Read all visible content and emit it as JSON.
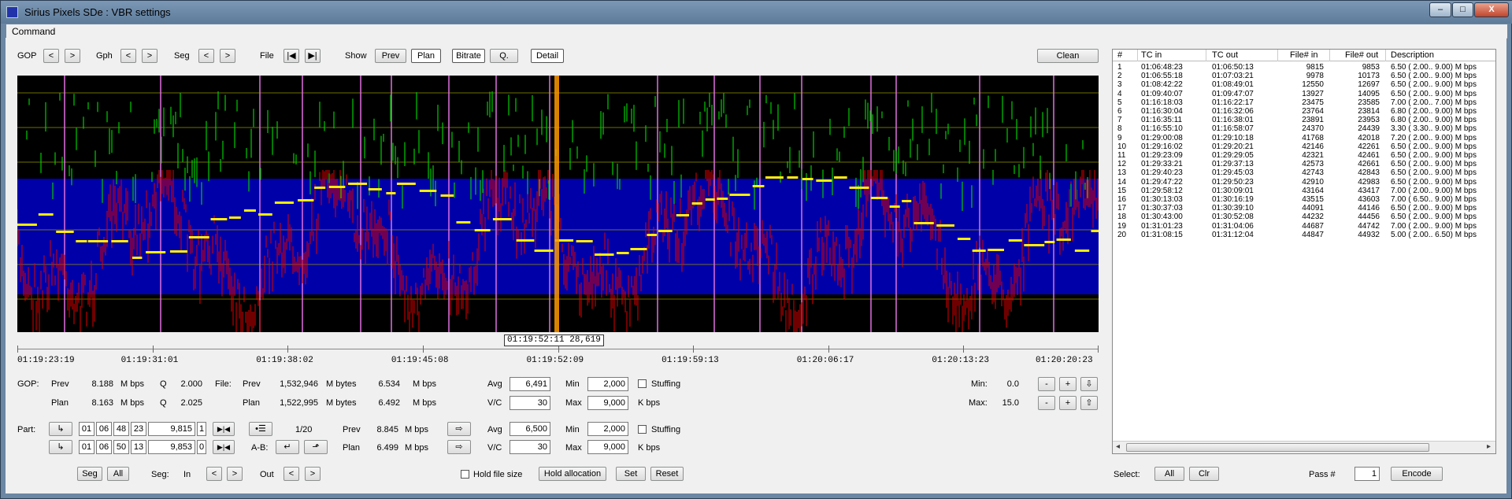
{
  "window": {
    "title": "Sirius Pixels SDe : VBR settings",
    "min_label": "–",
    "max_label": "□",
    "close_label": "X"
  },
  "menu": {
    "command": "Command"
  },
  "toolbar": {
    "gop": "GOP",
    "gph": "Gph",
    "seg": "Seg",
    "file": "File",
    "show": "Show",
    "prev_glyph": "<",
    "next_glyph": ">",
    "file_first": "|◀",
    "file_last": "▶|",
    "show_prev": "Prev",
    "show_plan": "Plan",
    "show_bitrate": "Bitrate",
    "show_q": "Q.",
    "show_detail": "Detail",
    "clean": "Clean"
  },
  "timeline": {
    "ticks": [
      "01:19:23:19",
      "01:19:31:01",
      "01:19:38:02",
      "01:19:45:08",
      "01:19:52:09",
      "01:19:59:13",
      "01:20:06:17",
      "01:20:13:23",
      "01:20:20:23"
    ],
    "cursor": "01:19:52:11 28,619"
  },
  "gop_stats": {
    "label": "GOP:",
    "prev_label": "Prev",
    "plan_label": "Plan",
    "prev_mbps": "8.188",
    "plan_mbps": "8.163",
    "unit": "M bps",
    "q_label": "Q",
    "prev_q": "2.000",
    "plan_q": "2.025"
  },
  "file_stats": {
    "label": "File:",
    "prev_label": "Prev",
    "plan_label": "Plan",
    "prev_bytes": "1,532,946",
    "plan_bytes": "1,522,995",
    "bytes_unit": "M bytes",
    "prev_mbps": "6.534",
    "plan_mbps": "6.492",
    "unit": "M bps"
  },
  "seg_vbr": {
    "avg_label": "Avg",
    "avg": "6,491",
    "vc_label": "V/C",
    "vc": "30",
    "min_label": "Min",
    "min": "2,000",
    "max_label": "Max",
    "max": "9,000",
    "kbps": "K bps",
    "stuffing": "Stuffing"
  },
  "minmax": {
    "min_label": "Min:",
    "min": "0.0",
    "max_label": "Max:",
    "max": "15.0",
    "minus": "-",
    "plus": "+",
    "down": "⇩",
    "up": "⇧"
  },
  "part": {
    "label": "Part:",
    "in": {
      "h": "01",
      "m": "06",
      "s": "48",
      "f": "23",
      "frame": "9,815",
      "flag": "1"
    },
    "out": {
      "h": "01",
      "m": "06",
      "s": "50",
      "f": "13",
      "frame": "9,853",
      "flag": "0"
    },
    "goto_glyph": "↳",
    "jump_glyph": "▶|◀",
    "list_glyph": "•☰",
    "count": "1/20",
    "ab_label": "A-B:",
    "ab_left": "↵",
    "ab_right": "⬏",
    "prev_label": "Prev",
    "prev_mbps": "8.845",
    "plan_label": "Plan",
    "plan_mbps": "6.499",
    "unit": "M bps",
    "arrow": "⇨"
  },
  "part_vbr": {
    "avg_label": "Avg",
    "avg": "6,500",
    "vc_label": "V/C",
    "vc": "30",
    "min_label": "Min",
    "min": "2,000",
    "max_label": "Max",
    "max": "9,000",
    "kbps": "K bps",
    "stuffing": "Stuffing"
  },
  "bottom": {
    "seg": "Seg",
    "all": "All",
    "seg_label": "Seg:",
    "in": "In",
    "out": "Out",
    "lt": "<",
    "gt": ">",
    "hold_file_size": "Hold file size",
    "hold_allocation": "Hold allocation",
    "set": "Set",
    "reset": "Reset",
    "select_label": "Select:",
    "select_all": "All",
    "clr": "Clr",
    "pass_label": "Pass #",
    "pass": "1",
    "encode": "Encode"
  },
  "segments_table": {
    "columns": [
      "#",
      "TC in",
      "TC out",
      "File# in",
      "File# out",
      "Description"
    ],
    "rows": [
      [
        "1",
        "01:06:48:23",
        "01:06:50:13",
        "9815",
        "9853",
        "6.50 ( 2.00.. 9.00) M bps"
      ],
      [
        "2",
        "01:06:55:18",
        "01:07:03:21",
        "9978",
        "10173",
        "6.50 ( 2.00.. 9.00) M bps"
      ],
      [
        "3",
        "01:08:42:22",
        "01:08:49:01",
        "12550",
        "12697",
        "6.50 ( 2.00.. 9.00) M bps"
      ],
      [
        "4",
        "01:09:40:07",
        "01:09:47:07",
        "13927",
        "14095",
        "6.50 ( 2.00.. 9.00) M bps"
      ],
      [
        "5",
        "01:16:18:03",
        "01:16:22:17",
        "23475",
        "23585",
        "7.00 ( 2.00.. 7.00) M bps"
      ],
      [
        "6",
        "01:16:30:04",
        "01:16:32:06",
        "23764",
        "23814",
        "6.80 ( 2.00.. 9.00) M bps"
      ],
      [
        "7",
        "01:16:35:11",
        "01:16:38:01",
        "23891",
        "23953",
        "6.80 ( 2.00.. 9.00) M bps"
      ],
      [
        "8",
        "01:16:55:10",
        "01:16:58:07",
        "24370",
        "24439",
        "3.30 ( 3.30.. 9.00) M bps"
      ],
      [
        "9",
        "01:29:00:08",
        "01:29:10:18",
        "41768",
        "42018",
        "7.20 ( 2.00.. 9.00) M bps"
      ],
      [
        "10",
        "01:29:16:02",
        "01:29:20:21",
        "42146",
        "42261",
        "6.50 ( 2.00.. 9.00) M bps"
      ],
      [
        "11",
        "01:29:23:09",
        "01:29:29:05",
        "42321",
        "42461",
        "6.50 ( 2.00.. 9.00) M bps"
      ],
      [
        "12",
        "01:29:33:21",
        "01:29:37:13",
        "42573",
        "42661",
        "6.50 ( 2.00.. 9.00) M bps"
      ],
      [
        "13",
        "01:29:40:23",
        "01:29:45:03",
        "42743",
        "42843",
        "6.50 ( 2.00.. 9.00) M bps"
      ],
      [
        "14",
        "01:29:47:22",
        "01:29:50:23",
        "42910",
        "42983",
        "6.50 ( 2.00.. 9.00) M bps"
      ],
      [
        "15",
        "01:29:58:12",
        "01:30:09:01",
        "43164",
        "43417",
        "7.00 ( 2.00.. 9.00) M bps"
      ],
      [
        "16",
        "01:30:13:03",
        "01:30:16:19",
        "43515",
        "43603",
        "7.00 ( 6.50.. 9.00) M bps"
      ],
      [
        "17",
        "01:30:37:03",
        "01:30:39:10",
        "44091",
        "44146",
        "6.50 ( 2.00.. 9.00) M bps"
      ],
      [
        "18",
        "01:30:43:00",
        "01:30:52:08",
        "44232",
        "44456",
        "6.50 ( 2.00.. 9.00) M bps"
      ],
      [
        "19",
        "01:31:01:23",
        "01:31:04:06",
        "44687",
        "44742",
        "7.00 ( 2.00.. 9.00) M bps"
      ],
      [
        "20",
        "01:31:08:15",
        "01:31:12:04",
        "44847",
        "44932",
        "5.00 ( 2.00.. 6.50) M bps"
      ]
    ]
  },
  "colors": {
    "graph_bg": "#000000",
    "band": "#0000a8",
    "grid": "#a0a000",
    "segment_marker": "#e070e0",
    "cursor": "#ff9900",
    "bitrate": "#e00000",
    "q_series": "#00cc00",
    "plan": "#ffee00"
  }
}
